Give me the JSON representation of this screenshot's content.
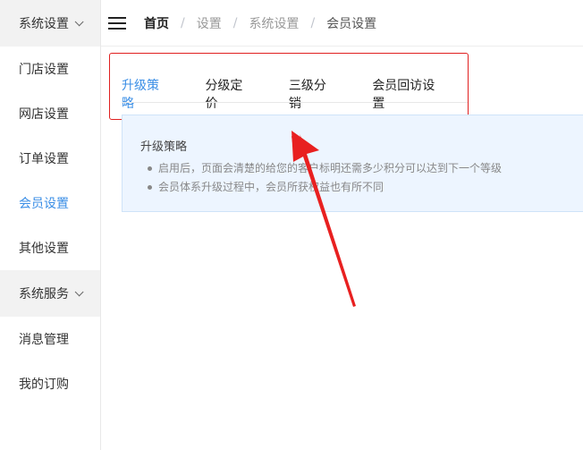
{
  "sidebar": {
    "groups": [
      {
        "label": "系统设置"
      },
      {
        "label": "系统服务"
      }
    ],
    "items": [
      {
        "label": "门店设置"
      },
      {
        "label": "网店设置"
      },
      {
        "label": "订单设置"
      },
      {
        "label": "会员设置"
      },
      {
        "label": "其他设置"
      },
      {
        "label": "消息管理"
      },
      {
        "label": "我的订购"
      }
    ]
  },
  "breadcrumb": {
    "home": "首页",
    "sep": "/",
    "items": [
      "设置",
      "系统设置"
    ],
    "current": "会员设置"
  },
  "tabs": [
    {
      "label": "升级策略"
    },
    {
      "label": "分级定价"
    },
    {
      "label": "三级分销"
    },
    {
      "label": "会员回访设置"
    }
  ],
  "info": {
    "title": "升级策略",
    "bullets": [
      "启用后，页面会清楚的给您的客户标明还需多少积分可以达到下一个等级",
      "会员体系升级过程中，会员所获权益也有所不同"
    ]
  },
  "colors": {
    "accent": "#3a8ee6",
    "annotation": "#e02020",
    "info_bg": "#edf5ff"
  }
}
